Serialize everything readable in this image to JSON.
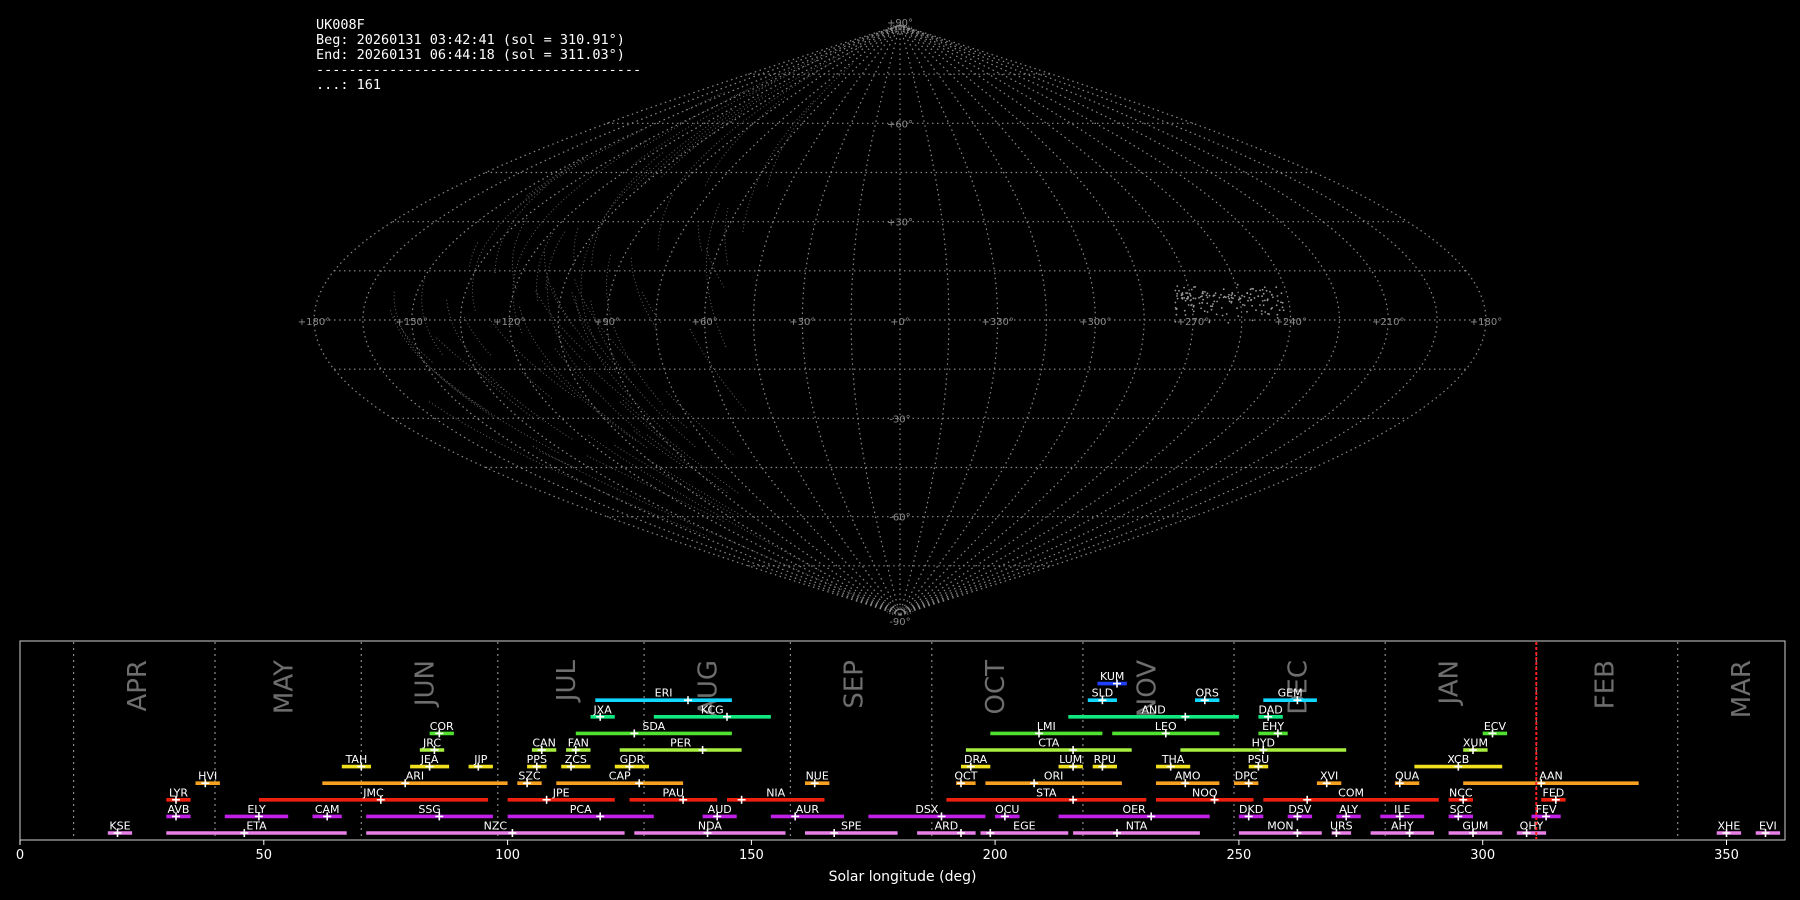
{
  "header": {
    "station": "UK008F",
    "begin": "Beg: 20260131 03:42:41 (sol = 310.91°)",
    "end": "End: 20260131 06:44:18 (sol = 311.03°)",
    "separator": "----------------------------------------",
    "count": "...: 161"
  },
  "sky_map": {
    "lon_labels": [
      "+180°",
      "+150°",
      "+120°",
      "+90°",
      "+60°",
      "+30°",
      "+0°",
      "+330°",
      "+300°",
      "+270°",
      "+240°",
      "+210°",
      "+180°"
    ],
    "lat_labels": [
      "+90°",
      "+60°",
      "+30°",
      "-30°",
      "-60°",
      "-90°"
    ],
    "grid_color": "#8a8a8a",
    "dense_region_lon_range": [
      198,
      300
    ]
  },
  "chart_data": {
    "type": "timeline",
    "xlabel": "Solar longitude (deg)",
    "xlim": [
      0,
      362
    ],
    "xticks": [
      0,
      50,
      100,
      150,
      200,
      250,
      300,
      350
    ],
    "current_sol": 311.0,
    "current_sol_color": "#ff2020",
    "months": [
      {
        "label": "APR",
        "start": 11,
        "center": 24
      },
      {
        "label": "MAY",
        "start": 40,
        "center": 54
      },
      {
        "label": "JUN",
        "start": 70,
        "center": 83
      },
      {
        "label": "JUL",
        "start": 98,
        "center": 112
      },
      {
        "label": "AUG",
        "start": 128,
        "center": 141
      },
      {
        "label": "SEP",
        "start": 158,
        "center": 171
      },
      {
        "label": "OCT",
        "start": 187,
        "center": 200
      },
      {
        "label": "NOV",
        "start": 218,
        "center": 231
      },
      {
        "label": "DEC",
        "start": 249,
        "center": 262
      },
      {
        "label": "JAN",
        "start": 280,
        "center": 293
      },
      {
        "label": "FEB",
        "start": 311,
        "center": 325
      },
      {
        "label": "MAR",
        "start": 340,
        "center": 353
      }
    ],
    "showers": [
      {
        "code": "KUM",
        "start": 221,
        "end": 227,
        "peak": 225,
        "row": 9,
        "color": "#2040ff"
      },
      {
        "code": "ERI",
        "start": 118,
        "end": 146,
        "peak": 137,
        "row": 8,
        "color": "#10d8ff"
      },
      {
        "code": "SLD",
        "start": 219,
        "end": 225,
        "peak": 222,
        "row": 8,
        "color": "#10d8ff"
      },
      {
        "code": "ORS",
        "start": 241,
        "end": 246,
        "peak": 243,
        "row": 8,
        "color": "#10d8ff"
      },
      {
        "code": "GEM",
        "start": 255,
        "end": 266,
        "peak": 262,
        "row": 8,
        "color": "#10d8ff"
      },
      {
        "code": "JXA",
        "start": 117,
        "end": 122,
        "peak": 119,
        "row": 7,
        "color": "#10e880"
      },
      {
        "code": "KCG",
        "start": 130,
        "end": 154,
        "peak": 145,
        "row": 7,
        "color": "#10e880"
      },
      {
        "code": "AND",
        "start": 215,
        "end": 250,
        "peak": 239,
        "row": 7,
        "color": "#10e880"
      },
      {
        "code": "DAD",
        "start": 254,
        "end": 259,
        "peak": 256,
        "row": 7,
        "color": "#10e880"
      },
      {
        "code": "COR",
        "start": 84,
        "end": 89,
        "peak": 86,
        "row": 6,
        "color": "#50e030"
      },
      {
        "code": "SDA",
        "start": 114,
        "end": 146,
        "peak": 126,
        "row": 6,
        "color": "#50e030"
      },
      {
        "code": "LMI",
        "start": 199,
        "end": 222,
        "peak": 209,
        "row": 6,
        "color": "#50e030"
      },
      {
        "code": "LEO",
        "start": 224,
        "end": 246,
        "peak": 235,
        "row": 6,
        "color": "#50e030"
      },
      {
        "code": "EHY",
        "start": 254,
        "end": 260,
        "peak": 258,
        "row": 6,
        "color": "#50e030"
      },
      {
        "code": "ECV",
        "start": 300,
        "end": 305,
        "peak": 302,
        "row": 6,
        "color": "#50e030"
      },
      {
        "code": "JRC",
        "start": 82,
        "end": 87,
        "peak": 85,
        "row": 5,
        "color": "#a8f040"
      },
      {
        "code": "CAN",
        "start": 105,
        "end": 110,
        "peak": 107,
        "row": 5,
        "color": "#a8f040"
      },
      {
        "code": "FAN",
        "start": 112,
        "end": 117,
        "peak": 114,
        "row": 5,
        "color": "#a8f040"
      },
      {
        "code": "PER",
        "start": 123,
        "end": 148,
        "peak": 140,
        "row": 5,
        "color": "#a8f040"
      },
      {
        "code": "CTA",
        "start": 194,
        "end": 228,
        "peak": 216,
        "row": 5,
        "color": "#a8f040"
      },
      {
        "code": "HYD",
        "start": 238,
        "end": 272,
        "peak": 255,
        "row": 5,
        "color": "#a8f040"
      },
      {
        "code": "XUM",
        "start": 296,
        "end": 301,
        "peak": 298,
        "row": 5,
        "color": "#a8f040"
      },
      {
        "code": "TAH",
        "start": 66,
        "end": 72,
        "peak": 70,
        "row": 4,
        "color": "#f0e020"
      },
      {
        "code": "JEA",
        "start": 80,
        "end": 88,
        "peak": 84,
        "row": 4,
        "color": "#f0e020"
      },
      {
        "code": "JIP",
        "start": 92,
        "end": 97,
        "peak": 94,
        "row": 4,
        "color": "#f0e020"
      },
      {
        "code": "PPS",
        "start": 104,
        "end": 108,
        "peak": 106,
        "row": 4,
        "color": "#f0e020"
      },
      {
        "code": "ZCS",
        "start": 111,
        "end": 117,
        "peak": 113,
        "row": 4,
        "color": "#f0e020"
      },
      {
        "code": "GDR",
        "start": 122,
        "end": 129,
        "peak": 125,
        "row": 4,
        "color": "#f0e020"
      },
      {
        "code": "DRA",
        "start": 193,
        "end": 199,
        "peak": 195,
        "row": 4,
        "color": "#f0e020"
      },
      {
        "code": "LUM",
        "start": 213,
        "end": 218,
        "peak": 216,
        "row": 4,
        "color": "#f0e020"
      },
      {
        "code": "RPU",
        "start": 220,
        "end": 225,
        "peak": 222,
        "row": 4,
        "color": "#f0e020"
      },
      {
        "code": "THA",
        "start": 233,
        "end": 240,
        "peak": 236,
        "row": 4,
        "color": "#f0e020"
      },
      {
        "code": "PSU",
        "start": 252,
        "end": 256,
        "peak": 254,
        "row": 4,
        "color": "#f0e020"
      },
      {
        "code": "XCB",
        "start": 286,
        "end": 304,
        "peak": 295,
        "row": 4,
        "color": "#f0e020"
      },
      {
        "code": "HVI",
        "start": 36,
        "end": 41,
        "peak": 38,
        "row": 3,
        "color": "#f8a020"
      },
      {
        "code": "ARI",
        "start": 62,
        "end": 100,
        "peak": 79,
        "row": 3,
        "color": "#f8a020"
      },
      {
        "code": "SZC",
        "start": 102,
        "end": 107,
        "peak": 104,
        "row": 3,
        "color": "#f8a020"
      },
      {
        "code": "CAP",
        "start": 110,
        "end": 136,
        "peak": 127,
        "row": 3,
        "color": "#f8a020"
      },
      {
        "code": "NUE",
        "start": 161,
        "end": 166,
        "peak": 163,
        "row": 3,
        "color": "#f8a020"
      },
      {
        "code": "OCT",
        "start": 192,
        "end": 196,
        "peak": 193,
        "row": 3,
        "color": "#f8a020"
      },
      {
        "code": "ORI",
        "start": 198,
        "end": 226,
        "peak": 208,
        "row": 3,
        "color": "#f8a020"
      },
      {
        "code": "AMO",
        "start": 233,
        "end": 246,
        "peak": 239,
        "row": 3,
        "color": "#f8a020"
      },
      {
        "code": "DPC",
        "start": 249,
        "end": 254,
        "peak": 252,
        "row": 3,
        "color": "#f8a020"
      },
      {
        "code": "XVI",
        "start": 266,
        "end": 271,
        "peak": 268,
        "row": 3,
        "color": "#f8a020"
      },
      {
        "code": "QUA",
        "start": 282,
        "end": 287,
        "peak": 283,
        "row": 3,
        "color": "#f8a020"
      },
      {
        "code": "AAN",
        "start": 296,
        "end": 332,
        "peak": 312,
        "row": 3,
        "color": "#f8a020"
      },
      {
        "code": "LYR",
        "start": 30,
        "end": 35,
        "peak": 32,
        "row": 2,
        "color": "#f02010"
      },
      {
        "code": "JMC",
        "start": 49,
        "end": 96,
        "peak": 74,
        "row": 2,
        "color": "#f02010"
      },
      {
        "code": "JPE",
        "start": 100,
        "end": 122,
        "peak": 108,
        "row": 2,
        "color": "#f02010"
      },
      {
        "code": "PAU",
        "start": 125,
        "end": 143,
        "peak": 136,
        "row": 2,
        "color": "#f02010"
      },
      {
        "code": "NIA",
        "start": 145,
        "end": 165,
        "peak": 148,
        "row": 2,
        "color": "#f02010"
      },
      {
        "code": "STA",
        "start": 190,
        "end": 231,
        "peak": 216,
        "row": 2,
        "color": "#f02010"
      },
      {
        "code": "NOO",
        "start": 233,
        "end": 253,
        "peak": 245,
        "row": 2,
        "color": "#f02010"
      },
      {
        "code": "COM",
        "start": 255,
        "end": 291,
        "peak": 264,
        "row": 2,
        "color": "#f02010"
      },
      {
        "code": "NCC",
        "start": 293,
        "end": 298,
        "peak": 296,
        "row": 2,
        "color": "#f02010"
      },
      {
        "code": "FED",
        "start": 312,
        "end": 317,
        "peak": 315,
        "row": 2,
        "color": "#f02010"
      },
      {
        "code": "AVB",
        "start": 30,
        "end": 35,
        "peak": 32,
        "row": 1,
        "color": "#c020e8"
      },
      {
        "code": "ELY",
        "start": 42,
        "end": 55,
        "peak": 49,
        "row": 1,
        "color": "#c020e8"
      },
      {
        "code": "CAM",
        "start": 60,
        "end": 66,
        "peak": 63,
        "row": 1,
        "color": "#c020e8"
      },
      {
        "code": "SSG",
        "start": 71,
        "end": 97,
        "peak": 86,
        "row": 1,
        "color": "#c020e8"
      },
      {
        "code": "PCA",
        "start": 100,
        "end": 130,
        "peak": 119,
        "row": 1,
        "color": "#c020e8"
      },
      {
        "code": "AUD",
        "start": 140,
        "end": 147,
        "peak": 143,
        "row": 1,
        "color": "#c020e8"
      },
      {
        "code": "AUR",
        "start": 154,
        "end": 169,
        "peak": 159,
        "row": 1,
        "color": "#c020e8"
      },
      {
        "code": "DSX",
        "start": 174,
        "end": 198,
        "peak": 189,
        "row": 1,
        "color": "#c020e8"
      },
      {
        "code": "OCU",
        "start": 200,
        "end": 205,
        "peak": 202,
        "row": 1,
        "color": "#c020e8"
      },
      {
        "code": "OER",
        "start": 213,
        "end": 244,
        "peak": 232,
        "row": 1,
        "color": "#c020e8"
      },
      {
        "code": "DKD",
        "start": 250,
        "end": 255,
        "peak": 252,
        "row": 1,
        "color": "#c020e8"
      },
      {
        "code": "DSV",
        "start": 260,
        "end": 265,
        "peak": 262,
        "row": 1,
        "color": "#c020e8"
      },
      {
        "code": "ALY",
        "start": 270,
        "end": 275,
        "peak": 272,
        "row": 1,
        "color": "#c020e8"
      },
      {
        "code": "ILE",
        "start": 279,
        "end": 288,
        "peak": 283,
        "row": 1,
        "color": "#c020e8"
      },
      {
        "code": "SCC",
        "start": 293,
        "end": 298,
        "peak": 295,
        "row": 1,
        "color": "#c020e8"
      },
      {
        "code": "FEV",
        "start": 310,
        "end": 316,
        "peak": 313,
        "row": 1,
        "color": "#c020e8"
      },
      {
        "code": "KSE",
        "start": 18,
        "end": 23,
        "peak": 20,
        "row": 0,
        "color": "#e880e8"
      },
      {
        "code": "ETA",
        "start": 30,
        "end": 67,
        "peak": 46,
        "row": 0,
        "color": "#e880e8"
      },
      {
        "code": "NZC",
        "start": 71,
        "end": 124,
        "peak": 101,
        "row": 0,
        "color": "#e880e8"
      },
      {
        "code": "NDA",
        "start": 126,
        "end": 157,
        "peak": 141,
        "row": 0,
        "color": "#e880e8"
      },
      {
        "code": "SPE",
        "start": 161,
        "end": 180,
        "peak": 167,
        "row": 0,
        "color": "#e880e8"
      },
      {
        "code": "ARD",
        "start": 184,
        "end": 196,
        "peak": 193,
        "row": 0,
        "color": "#e880e8"
      },
      {
        "code": "EGE",
        "start": 197,
        "end": 215,
        "peak": 199,
        "row": 0,
        "color": "#e880e8"
      },
      {
        "code": "NTA",
        "start": 216,
        "end": 242,
        "peak": 225,
        "row": 0,
        "color": "#e880e8"
      },
      {
        "code": "MON",
        "start": 250,
        "end": 267,
        "peak": 262,
        "row": 0,
        "color": "#e880e8"
      },
      {
        "code": "URS",
        "start": 269,
        "end": 273,
        "peak": 270,
        "row": 0,
        "color": "#e880e8"
      },
      {
        "code": "AHY",
        "start": 277,
        "end": 290,
        "peak": 285,
        "row": 0,
        "color": "#e880e8"
      },
      {
        "code": "GUM",
        "start": 293,
        "end": 304,
        "peak": 298,
        "row": 0,
        "color": "#e880e8"
      },
      {
        "code": "OHY",
        "start": 307,
        "end": 313,
        "peak": 309,
        "row": 0,
        "color": "#e880e8"
      },
      {
        "code": "XHE",
        "start": 348,
        "end": 353,
        "peak": 350,
        "row": 0,
        "color": "#e880e8"
      },
      {
        "code": "EVI",
        "start": 356,
        "end": 361,
        "peak": 358,
        "row": 0,
        "color": "#e880e8"
      }
    ]
  }
}
